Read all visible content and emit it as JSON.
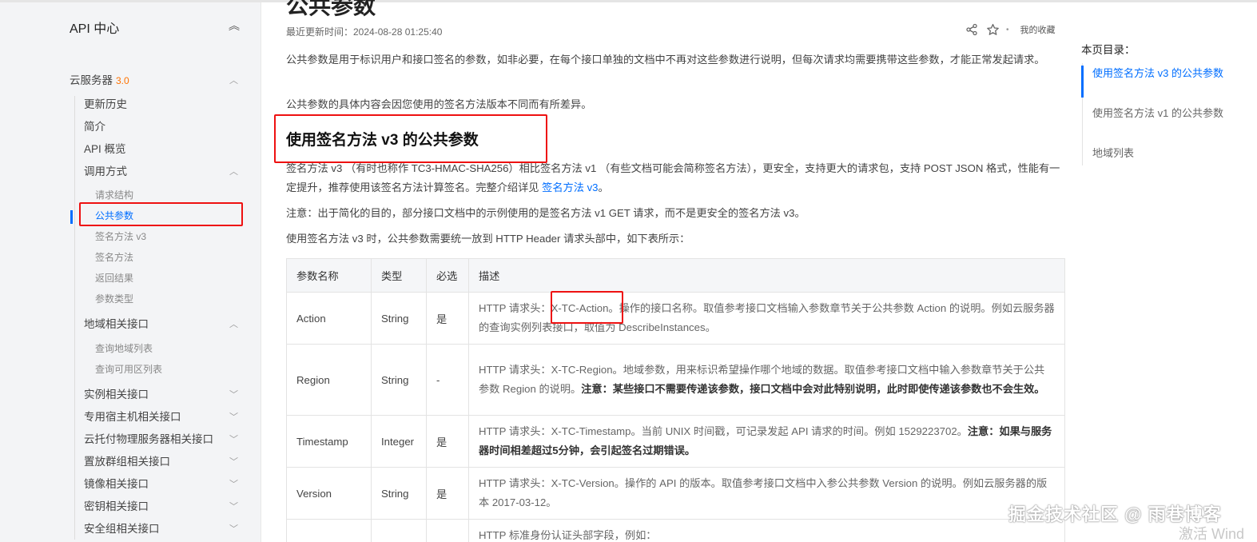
{
  "sidebar": {
    "title": "API 中心",
    "product": {
      "label": "云服务器",
      "version": "3.0"
    },
    "items": [
      "更新历史",
      "简介",
      "API 概览",
      "调用方式"
    ],
    "sub_calling": [
      "请求结构",
      "公共参数",
      "签名方法 v3",
      "签名方法",
      "返回结果",
      "参数类型"
    ],
    "region_group": "地域相关接口",
    "sub_region": [
      "查询地域列表",
      "查询可用区列表"
    ],
    "groups": [
      "实例相关接口",
      "专用宿主机相关接口",
      "云托付物理服务器相关接口",
      "置放群组相关接口",
      "镜像相关接口",
      "密钥相关接口",
      "安全组相关接口"
    ]
  },
  "header": {
    "title": "公共参数",
    "updated": "最近更新时间：2024-08-28 01:25:40",
    "favorites": "我的收藏"
  },
  "content": {
    "p1": "公共参数是用于标识用户和接口签名的参数，如非必要，在每个接口单独的文档中不再对这些参数进行说明，但每次请求均需要携带这些参数，才能正常发起请求。",
    "p2": "公共参数的具体内容会因您使用的签名方法版本不同而有所差异。",
    "h2": "使用签名方法 v3 的公共参数",
    "p3_a": "签名方法 v3 （有时也称作 TC3-HMAC-SHA256）相比签名方法 v1 （有些文档可能会简称签名方法），更安全，支持更大的请求包，支持 POST JSON 格式，性能有一定提升，推荐使用该签名方法计算签名。完整介绍详见 ",
    "p3_link": "签名方法 v3",
    "p3_end": "。",
    "p4": "注意：出于简化的目的，部分接口文档中的示例使用的是签名方法 v1 GET 请求，而不是更安全的签名方法 v3。",
    "p5": "使用签名方法 v3 时，公共参数需要统一放到 HTTP Header 请求头部中，如下表所示："
  },
  "table": {
    "headers": [
      "参数名称",
      "类型",
      "必选",
      "描述"
    ],
    "rows": [
      {
        "name": "Action",
        "type": "String",
        "required": "是",
        "desc_a": "HTTP 请求头：",
        "desc_key": "X-TC-Action",
        "desc_b": "。操作的接口名称。取值参考接口文档输入参数章节关于公共参数 Action 的说明。例如云服务器的查询实例列表接口，取值为 DescribeInstances。"
      },
      {
        "name": "Region",
        "type": "String",
        "required": "-",
        "desc_a": "HTTP 请求头：X-TC-Region。地域参数，用来标识希望操作哪个地域的数据。取值参考接口文档中输入参数章节关于公共参数 Region 的说明。",
        "desc_bold": "注意：某些接口不需要传递该参数，接口文档中会对此特别说明，此时即使传递该参数也不会生效。"
      },
      {
        "name": "Timestamp",
        "type": "Integer",
        "required": "是",
        "desc_a": "HTTP 请求头：X-TC-Timestamp。当前 UNIX 时间戳，可记录发起 API 请求的时间。例如 1529223702。",
        "desc_bold": "注意：如果与服务器时间相差超过5分钟，会引起签名过期错误。"
      },
      {
        "name": "Version",
        "type": "String",
        "required": "是",
        "desc_a": "HTTP 请求头：X-TC-Version。操作的 API 的版本。取值参考接口文档中入参公共参数 Version 的说明。例如云服务器的版本 2017-03-12。"
      },
      {
        "name": "",
        "type": "",
        "required": "",
        "desc_a": "HTTP 标准身份认证头部字段，例如："
      }
    ]
  },
  "toc": {
    "title": "本页目录：",
    "items": [
      "使用签名方法 v3 的公共参数",
      "使用签名方法 v1 的公共参数",
      "地域列表"
    ]
  },
  "overlay": {
    "watermark": "掘金技术社区 @ 雨巷博客",
    "windows": "激活 Wind"
  },
  "colors": {
    "accent": "#006eff",
    "version": "#ff7200",
    "annotation": "#ee1111"
  }
}
